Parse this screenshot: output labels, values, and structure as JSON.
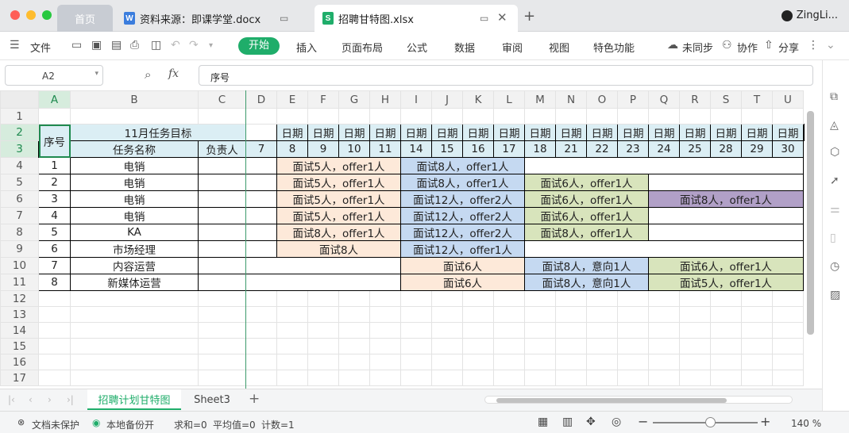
{
  "tabs": {
    "home": "首页",
    "doc": {
      "icon": "W",
      "title": "资料来源：即课学堂.docx"
    },
    "xls": {
      "icon": "S",
      "title": "招聘甘特图.xlsx"
    },
    "user": "ZingLi..."
  },
  "menu": {
    "file": "文件",
    "start": "开始",
    "insert": "插入",
    "layout": "页面布局",
    "formula": "公式",
    "data": "数据",
    "review": "审阅",
    "view": "视图",
    "special": "特色功能",
    "sync": "未同步",
    "collab": "协作",
    "share": "分享"
  },
  "formula_bar": {
    "cell_ref": "A2",
    "fx": "fx",
    "content": "序号"
  },
  "columns": [
    "A",
    "B",
    "C",
    "D",
    "E",
    "F",
    "G",
    "H",
    "I",
    "J",
    "K",
    "L",
    "M",
    "N",
    "O",
    "P",
    "Q",
    "R",
    "S",
    "T",
    "U"
  ],
  "selected_column": "A",
  "row_numbers": [
    "1",
    "2",
    "3",
    "4",
    "5",
    "6",
    "7",
    "8",
    "9",
    "10",
    "11",
    "12",
    "13",
    "14",
    "15",
    "16",
    "17"
  ],
  "header": {
    "seq": "序号",
    "goal": "11月任务目标",
    "task_name": "任务名称",
    "owner": "负责人",
    "date_label": "日期",
    "dates": [
      "7",
      "8",
      "9",
      "10",
      "11",
      "14",
      "15",
      "16",
      "17",
      "18",
      "21",
      "22",
      "23",
      "24",
      "25",
      "28",
      "29",
      "30"
    ]
  },
  "rows": [
    {
      "num": "4",
      "seq": "1",
      "name": "电销",
      "segs": [
        {
          "text": "面试5人，offer1人",
          "color": "orange"
        },
        {
          "text": "面试8人，offer1人",
          "color": "blue"
        }
      ]
    },
    {
      "num": "5",
      "seq": "2",
      "name": "电销",
      "segs": [
        {
          "text": "面试5人，offer1人",
          "color": "orange"
        },
        {
          "text": "面试8人，offer1人",
          "color": "blue"
        },
        {
          "text": "面试6人，offer1人",
          "color": "green"
        }
      ]
    },
    {
      "num": "6",
      "seq": "3",
      "name": "电销",
      "segs": [
        {
          "text": "面试5人，offer1人",
          "color": "orange"
        },
        {
          "text": "面试12人，offer2人",
          "color": "blue"
        },
        {
          "text": "面试6人，offer1人",
          "color": "green"
        },
        {
          "text": "面试8人，offer1人",
          "color": "purple"
        }
      ]
    },
    {
      "num": "7",
      "seq": "4",
      "name": "电销",
      "segs": [
        {
          "text": "面试5人，offer1人",
          "color": "orange"
        },
        {
          "text": "面试12人，offer2人",
          "color": "blue"
        },
        {
          "text": "面试6人，offer1人",
          "color": "green"
        }
      ]
    },
    {
      "num": "8",
      "seq": "5",
      "name": "KA",
      "segs": [
        {
          "text": "面试8人，offer1人",
          "color": "orange"
        },
        {
          "text": "面试12人，offer2人",
          "color": "blue"
        },
        {
          "text": "面试8人，offer1人",
          "color": "green"
        }
      ]
    },
    {
      "num": "9",
      "seq": "6",
      "name": "市场经理",
      "segs": [
        {
          "text": "面试8人",
          "color": "orange"
        },
        {
          "text": "面试12人，offer1人",
          "color": "blue"
        }
      ]
    },
    {
      "num": "10",
      "seq": "7",
      "name": "内容运营",
      "segs": [
        {
          "text": "面试6人",
          "color": "orange"
        },
        {
          "text": "面试8人，意向1人",
          "color": "blue"
        },
        {
          "text": "面试6人，offer1人",
          "color": "green"
        }
      ]
    },
    {
      "num": "11",
      "seq": "8",
      "name": "新媒体运营",
      "segs": [
        {
          "text": "面试6人",
          "color": "orange"
        },
        {
          "text": "面试8人，意向1人",
          "color": "blue"
        },
        {
          "text": "面试5人，offer1人",
          "color": "green"
        }
      ]
    }
  ],
  "sheet_tabs": {
    "active": "招聘计划甘特图",
    "other": "Sheet3"
  },
  "status": {
    "protect": "文档未保护",
    "backup": "本地备份开",
    "sum": "求和=0",
    "avg": "平均值=0",
    "count": "计数=1",
    "zoom": "140 %"
  },
  "colors": {
    "accent": "#1fad6a",
    "header_fill": "#dbeef4",
    "orange": "#fde9d9",
    "blue": "#c5d9f1",
    "green": "#d8e4bc",
    "purple": "#b1a0c7"
  }
}
